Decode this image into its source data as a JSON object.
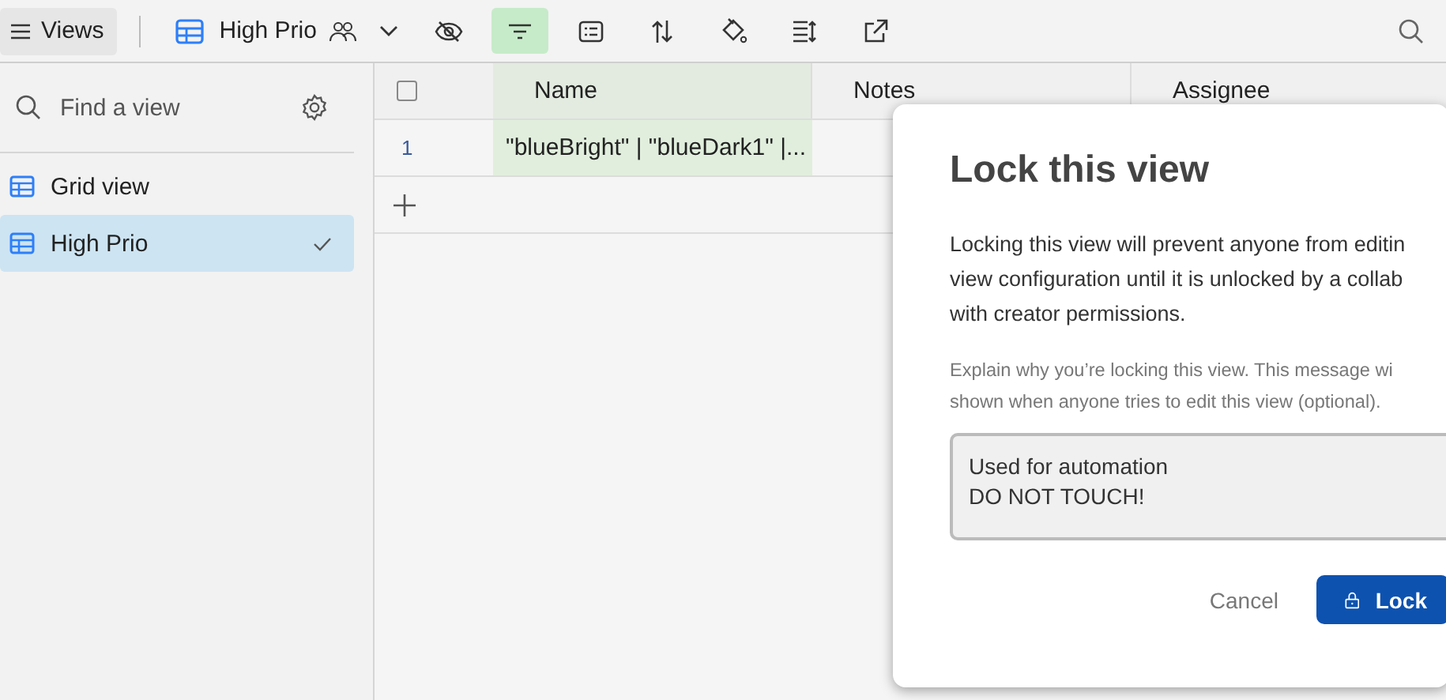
{
  "toolbar": {
    "views_button": "Views",
    "view_title": "High Prio",
    "tools": [
      {
        "kind": "hide",
        "selected": false
      },
      {
        "kind": "filter",
        "selected": true
      },
      {
        "kind": "group",
        "selected": false
      },
      {
        "kind": "sort",
        "selected": false
      },
      {
        "kind": "color",
        "selected": false
      },
      {
        "kind": "height",
        "selected": false
      },
      {
        "kind": "share",
        "selected": false
      }
    ]
  },
  "sidebar": {
    "search": {
      "placeholder": "Find a view"
    },
    "items": [
      {
        "label": "Grid view",
        "selected": false
      },
      {
        "label": "High Prio",
        "selected": true
      }
    ]
  },
  "table": {
    "select_all": {
      "checked": false
    },
    "columns": [
      "Name",
      "Notes",
      "Assignee"
    ],
    "rows": [
      {
        "number": "1",
        "cells": [
          "\"blueBright\" | \"blueDark1\" |..."
        ]
      }
    ]
  },
  "dialog": {
    "title": "Lock this view",
    "description_lines": [
      "Locking this view will prevent anyone from editin",
      "view configuration until it is unlocked by a collab",
      "with creator permissions."
    ],
    "hint_lines": [
      "Explain why you’re locking this view. This message wi",
      "shown when anyone tries to edit this view (optional)."
    ],
    "message": "Used for automation\nDO NOT TOUCH!",
    "cancel": "Cancel",
    "confirm": "Lock"
  }
}
